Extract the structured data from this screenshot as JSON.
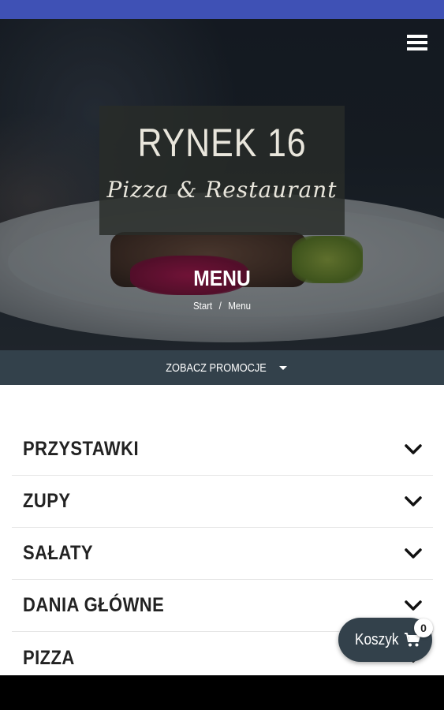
{
  "hero": {
    "logo_title": "RYNEK 16",
    "logo_subtitle": "Pizza & Restaurant",
    "page_title": "MENU",
    "breadcrumb": {
      "home": "Start",
      "separator": "/",
      "current": "Menu"
    }
  },
  "header": {
    "menu_icon": "hamburger-icon"
  },
  "promo": {
    "label": "ZOBACZ PROMOCJE",
    "icon": "caret-down-icon"
  },
  "menu": {
    "categories": [
      {
        "label": "PRZYSTAWKI"
      },
      {
        "label": "ZUPY"
      },
      {
        "label": "SAŁATY"
      },
      {
        "label": "DANIA GŁÓWNE"
      },
      {
        "label": "PIZZA"
      }
    ],
    "expand_icon": "chevron-down-icon"
  },
  "cart": {
    "label": "Koszyk",
    "count": "0",
    "icon": "shopping-cart-icon"
  },
  "colors": {
    "status_bar": "#3f51b5",
    "accent_dark": "#33414b",
    "text": "#222222"
  }
}
